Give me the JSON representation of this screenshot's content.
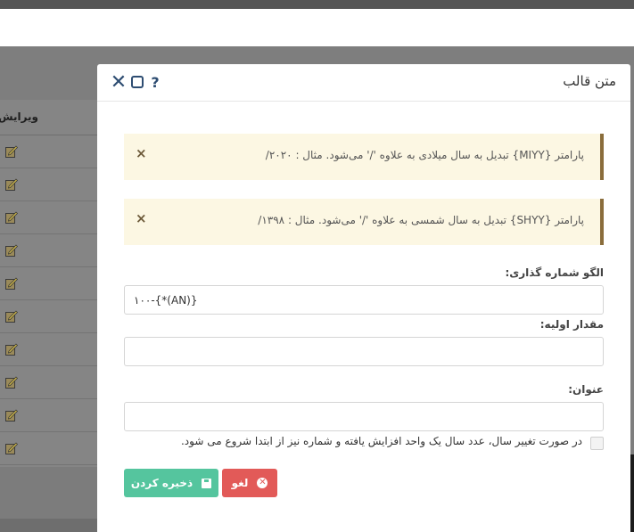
{
  "background": {
    "column_header": "ویرایش",
    "edit_icon": "pencil-icon",
    "row_count": 10
  },
  "modal": {
    "title": "متن قالب",
    "help_label": "?",
    "close_label": "✕",
    "alerts": [
      {
        "text": "پارامتر {MIYY} تبدیل به سال میلادی به علاوه '/' می‌شود. مثال : ۲۰۲۰/"
      },
      {
        "text": "پارامتر {SHYY} تبدیل به سال شمسی به علاوه '/' می‌شود. مثال : ۱۳۹۸/"
      }
    ],
    "alert_close_label": "×",
    "fields": {
      "pattern_label": "الگو شماره گذاری:",
      "pattern_value": "۱۰۰-{*(AN)}",
      "initial_label": "مقدار اولیه:",
      "initial_value": "",
      "title_label": "عنوان:",
      "title_value": ""
    },
    "checkbox_label": "در صورت تغییر سال، عدد سال یک واحد افزایش یافته و شماره نیز از ابتدا شروع می شود.",
    "buttons": {
      "cancel_label": "لغو",
      "save_label": "ذخیره کردن"
    },
    "colors": {
      "save": "#55c59e",
      "cancel": "#e25a58",
      "alert_bg": "#fcf7e3",
      "alert_border": "#8a6d3b",
      "header_icons": "#2e4d72"
    }
  }
}
